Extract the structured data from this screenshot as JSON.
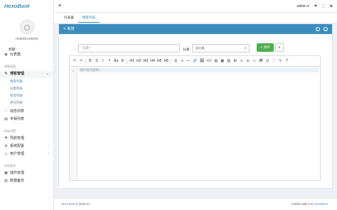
{
  "app": {
    "logo": "HexoBoot",
    "user_name": "ADMIN(ADMIN)"
  },
  "sidebar": {
    "top_item": {
      "label": "仪表盘",
      "icon": "dashboard-icon"
    },
    "group1": "博客管理",
    "blog_manage": {
      "label": "博客管理",
      "icon": "edit-icon",
      "sub": [
        "博客列表",
        "分类列表",
        "标签列表",
        "评论列表"
      ]
    },
    "items1": [
      {
        "label": "动态列表",
        "icon": "heart-icon"
      },
      {
        "label": "专辑列表",
        "icon": "list-icon"
      }
    ],
    "group2": "网站设置",
    "items2": [
      {
        "label": "导航管理",
        "icon": "nav-icon",
        "arrow": false
      },
      {
        "label": "系统配置",
        "icon": "gear-icon",
        "arrow": true
      },
      {
        "label": "用户管理",
        "icon": "user-icon",
        "arrow": true
      }
    ],
    "group3": "系统管理",
    "items3": [
      {
        "label": "插件管理",
        "icon": "plugin-icon"
      },
      {
        "label": "数据备份",
        "icon": "backup-icon"
      }
    ]
  },
  "topbar": {
    "user": "admin",
    "caret": "▾"
  },
  "tabs": [
    {
      "label": "仪表盘",
      "active": false
    },
    {
      "label": "博客列表",
      "active": true
    }
  ],
  "panel": {
    "title": "新增",
    "title_label": "标题",
    "title_placeholder": "标题 *",
    "category_label": "分类",
    "category_value": "无分类",
    "save_label": "保存"
  },
  "editor": {
    "toolbar": [
      "↶",
      "↷",
      "B",
      "S",
      "I",
      "❝",
      "Aa",
      "A",
      "H1",
      "H2",
      "H3",
      "H4",
      "H5",
      "H6",
      "☰",
      "≡",
      "—",
      "🔗",
      "🖼",
      "</>",
      "▤",
      "▦",
      "▥",
      "⊞",
      "☺",
      "⊙",
      "▭",
      "👁",
      "⊡",
      "⛶",
      "✎",
      "?"
    ],
    "line_number": "1",
    "placeholder": "请开始内容吧~"
  },
  "footer": {
    "left_prefix": "Hexo Boot",
    "left_suffix": "© 2020-21",
    "right_prefix": "Crafted with",
    "right_suffix": "by HexoBoot."
  },
  "colors": {
    "accent": "#3c8dbc",
    "save": "#4cae4c"
  }
}
